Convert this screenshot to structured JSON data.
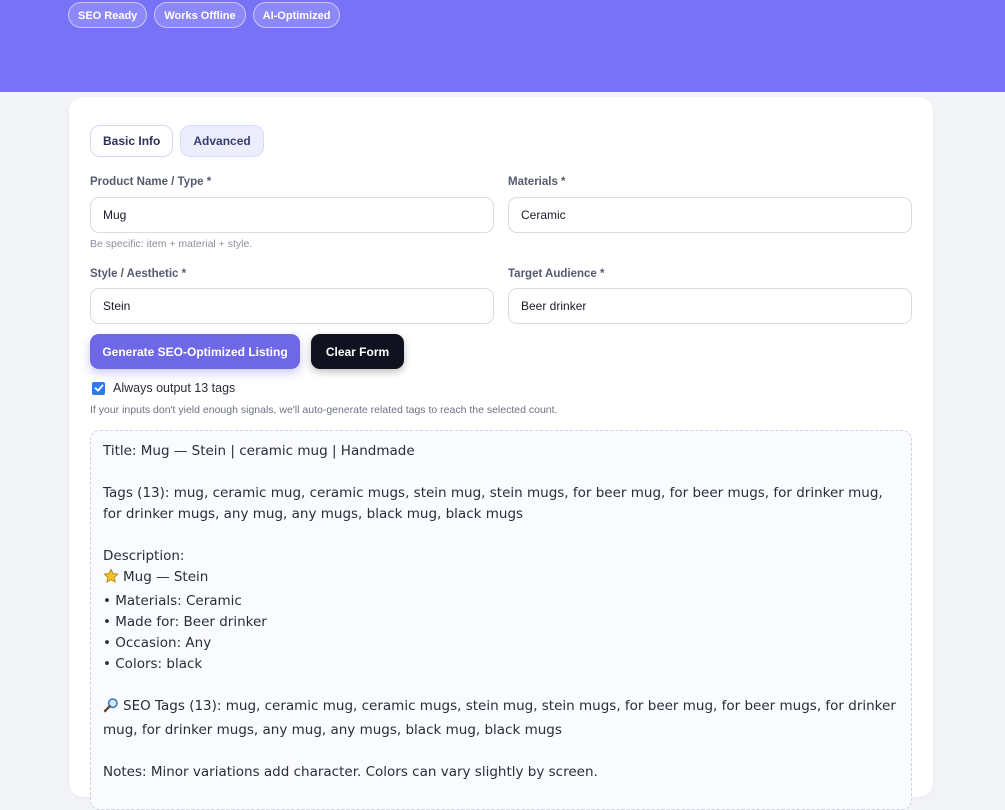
{
  "header": {
    "badges": [
      "SEO Ready",
      "Works Offline",
      "AI-Optimized"
    ],
    "background_color": "#7872f6"
  },
  "tabs": [
    {
      "label": "Basic Info"
    },
    {
      "label": "Advanced"
    }
  ],
  "form": {
    "product_name": {
      "label": "Product Name / Type *",
      "value": "Mug",
      "hint": "Be specific: item + material + style."
    },
    "materials": {
      "label": "Materials *",
      "value": "Ceramic"
    },
    "style": {
      "label": "Style / Aesthetic *",
      "value": "Stein"
    },
    "audience": {
      "label": "Target Audience *",
      "value": "Beer drinker"
    }
  },
  "actions": {
    "generate_label": "Generate SEO-Optimized Listing",
    "clear_label": "Clear Form",
    "accent_color": "#6e67e6"
  },
  "options": {
    "always_13_tags": {
      "label": "Always output 13 tags",
      "checked": true
    },
    "note": "If your inputs don't yield enough signals, we'll auto-generate related tags to reach the selected count."
  },
  "output": {
    "title_line": "Title: Mug — Stein | ceramic mug | Handmade",
    "tags_line": "Tags (13): mug, ceramic mug, ceramic mugs, stein mug, stein mugs, for beer mug, for beer mugs, for drinker mug, for drinker mugs, any mug, any mugs, black mug, black mugs",
    "description_heading": "Description:",
    "description_headline": "Mug — Stein",
    "description_headline_icon": "star-icon",
    "bullets": [
      "• Materials: Ceramic",
      "• Made for: Beer drinker",
      "• Occasion: Any",
      "• Colors: black"
    ],
    "seo_tags_icon": "magnifier-icon",
    "seo_tags_line": "SEO Tags (13): mug, ceramic mug, ceramic mugs, stein mug, stein mugs, for beer mug, for beer mugs, for drinker mug, for drinker mugs, any mug, any mugs, black mug, black mugs",
    "notes_line": "Notes: Minor variations add character. Colors can vary slightly by screen."
  }
}
